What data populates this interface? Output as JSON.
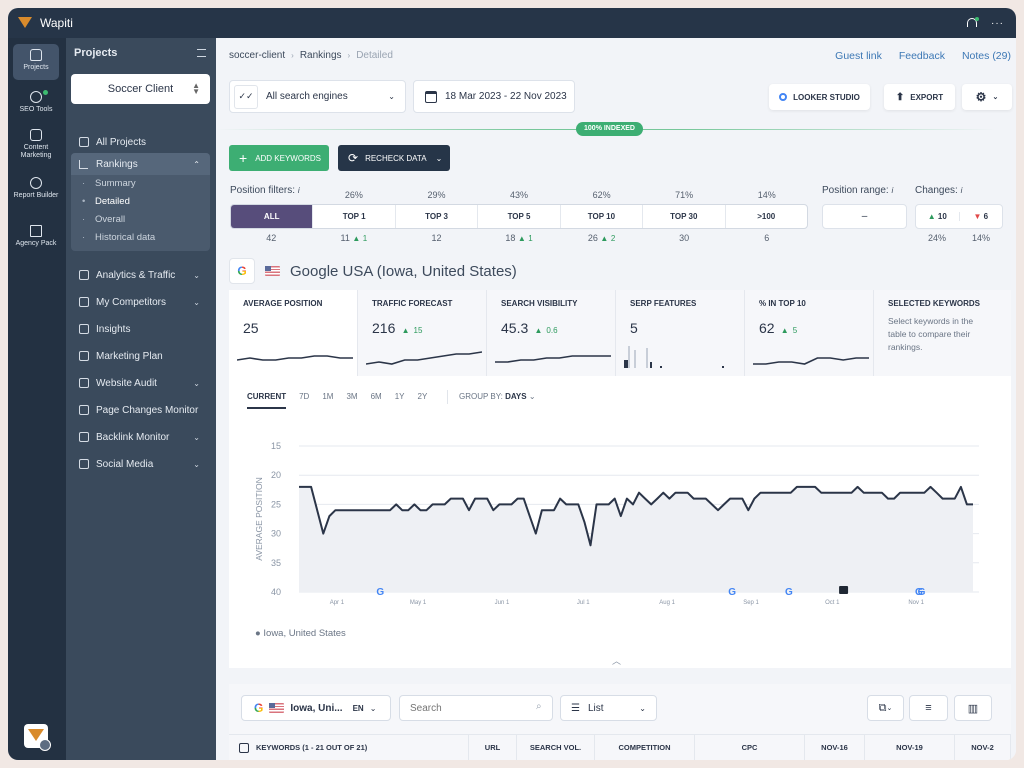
{
  "app": {
    "title": "Wapiti"
  },
  "rail": [
    {
      "label": "Projects",
      "icon": "home-icon",
      "active": true
    },
    {
      "label": "SEO Tools",
      "icon": "search-icon"
    },
    {
      "label": "Content Marketing",
      "icon": "edit-icon"
    },
    {
      "label": "Report Builder",
      "icon": "pie-chart-icon"
    },
    {
      "label": "Agency Pack",
      "icon": "building-icon"
    }
  ],
  "sidebar": {
    "title": "Projects",
    "project": "Soccer Client",
    "all_projects": "All Projects",
    "rankings": {
      "label": "Rankings",
      "subitems": [
        "Summary",
        "Detailed",
        "Overall",
        "Historical data"
      ],
      "active_sub": "Detailed"
    },
    "items": [
      {
        "label": "Analytics & Traffic",
        "icon": "activity-icon",
        "chevron": true
      },
      {
        "label": "My Competitors",
        "icon": "users-icon",
        "chevron": true
      },
      {
        "label": "Insights",
        "icon": "trend-icon",
        "chevron": false
      },
      {
        "label": "Marketing Plan",
        "icon": "checklist-icon",
        "chevron": false
      },
      {
        "label": "Website Audit",
        "icon": "audit-icon",
        "chevron": true
      },
      {
        "label": "Page Changes Monitor",
        "icon": "compare-icon",
        "chevron": false
      },
      {
        "label": "Backlink Monitor",
        "icon": "link-icon",
        "chevron": true
      },
      {
        "label": "Social Media",
        "icon": "thumbs-up-icon",
        "chevron": true
      }
    ]
  },
  "breadcrumb": [
    "soccer-client",
    "Rankings",
    "Detailed"
  ],
  "toplinks": {
    "guest": "Guest link",
    "feedback": "Feedback",
    "notes": "Notes (29)"
  },
  "toolbar": {
    "engines": "All search engines",
    "date_range": "18 Mar 2023 - 22 Nov 2023",
    "looker": "LOOKER STUDIO",
    "export": "EXPORT",
    "indexed": "100% INDEXED",
    "add_keywords": "ADD KEYWORDS",
    "recheck": "RECHECK DATA"
  },
  "position_filters": {
    "label": "Position filters:",
    "cells": [
      {
        "label": "ALL",
        "pct": "",
        "count": "42",
        "delta": ""
      },
      {
        "label": "TOP 1",
        "pct": "26%",
        "count": "11",
        "delta": "1"
      },
      {
        "label": "TOP 3",
        "pct": "29%",
        "count": "12",
        "delta": ""
      },
      {
        "label": "TOP 5",
        "pct": "43%",
        "count": "18",
        "delta": "1"
      },
      {
        "label": "TOP 10",
        "pct": "62%",
        "count": "26",
        "delta": "2"
      },
      {
        "label": "TOP 30",
        "pct": "71%",
        "count": "30",
        "delta": ""
      },
      {
        "label": ">100",
        "pct": "14%",
        "count": "6",
        "delta": ""
      }
    ],
    "range_label": "Position range:",
    "range_value": "–",
    "changes_label": "Changes:",
    "changes_up": "10",
    "changes_down": "6",
    "changes_up_pct": "24%",
    "changes_down_pct": "14%"
  },
  "engine": {
    "title": "Google USA (Iowa, United States)"
  },
  "stats": [
    {
      "label": "AVERAGE POSITION",
      "value": "25",
      "delta": ""
    },
    {
      "label": "TRAFFIC FORECAST",
      "value": "216",
      "delta": "15"
    },
    {
      "label": "SEARCH VISIBILITY",
      "value": "45.3",
      "delta": "0.6"
    },
    {
      "label": "SERP FEATURES",
      "value": "5",
      "delta": ""
    },
    {
      "label": "% IN TOP 10",
      "value": "62",
      "delta": "5"
    },
    {
      "label": "SELECTED KEYWORDS",
      "note": "Select keywords in the table to compare their rankings."
    }
  ],
  "periods": [
    "CURRENT",
    "7D",
    "1M",
    "3M",
    "6M",
    "1Y",
    "2Y"
  ],
  "group_by": {
    "label": "GROUP BY:",
    "value": "DAYS"
  },
  "chart_data": {
    "type": "line",
    "title": "",
    "ylabel": "AVERAGE POSITION",
    "xlabel": "",
    "ylim": [
      40,
      15
    ],
    "yticks": [
      15,
      20,
      25,
      30,
      35,
      40
    ],
    "xticks": [
      "Apr 1",
      "May 1",
      "Jun 1",
      "Jul 1",
      "Aug 1",
      "Sep 1",
      "Oct 1",
      "Nov 1"
    ],
    "x_start": "2023-03-18",
    "x_end": "2023-11-22",
    "series": [
      {
        "name": "Iowa, United States",
        "values": [
          22,
          22,
          22,
          26,
          30,
          27,
          26,
          26,
          26,
          26,
          26,
          26,
          26,
          26,
          26,
          26,
          25,
          26,
          26,
          25,
          26,
          26,
          25,
          25,
          25,
          24,
          24,
          24,
          26,
          24,
          24,
          24,
          26,
          25,
          25,
          25,
          24,
          24,
          27,
          30,
          26,
          26,
          26,
          24,
          25,
          25,
          25,
          28,
          32,
          25,
          25,
          25,
          24,
          27,
          24,
          25,
          23,
          24,
          25,
          24,
          23,
          24,
          23,
          23,
          23,
          24,
          24,
          24,
          25,
          26,
          25,
          24,
          24,
          24,
          26,
          24,
          23,
          23,
          23,
          23,
          23,
          23,
          22,
          22,
          22,
          22,
          23,
          23,
          23,
          23,
          23,
          23,
          22,
          23,
          23,
          23,
          23,
          24,
          24,
          23,
          23,
          23,
          23,
          23,
          22,
          23,
          24,
          24,
          24,
          22,
          25,
          25
        ]
      }
    ],
    "annotations": [
      {
        "type": "google-update",
        "date": "Apr 17"
      },
      {
        "type": "google-update",
        "date": "Aug 25"
      },
      {
        "type": "google-update",
        "date": "Sep 15"
      },
      {
        "type": "note",
        "date": "Oct 5"
      },
      {
        "type": "google-update",
        "date": "Nov 2"
      },
      {
        "type": "google-update",
        "date": "Nov 3"
      }
    ],
    "legend": "bottom-left"
  },
  "keywords_table": {
    "location": "Iowa, Uni...",
    "lang": "EN",
    "search_placeholder": "Search",
    "view": "List",
    "columns": [
      "KEYWORDS (1 - 21 OUT OF 21)",
      "URL",
      "SEARCH VOL.",
      "COMPETITION",
      "CPC",
      "NOV-16",
      "NOV-19",
      "NOV-2"
    ]
  }
}
